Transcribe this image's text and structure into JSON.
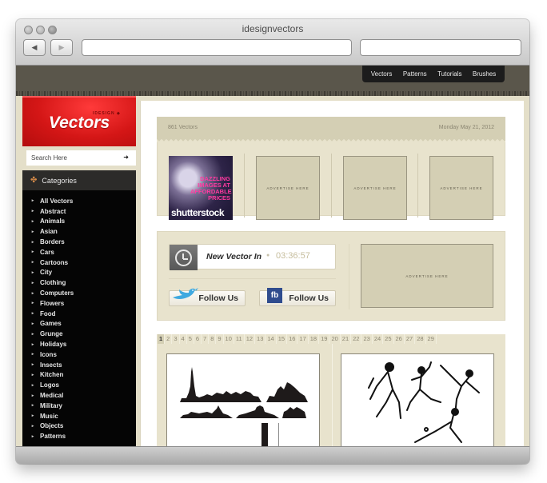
{
  "window": {
    "title": "idesignvectors"
  },
  "browser": {
    "back_icon": "back-arrow-icon",
    "forward_icon": "forward-arrow-icon",
    "back_glyph": "◀",
    "forward_glyph": "▶",
    "url_value": "",
    "search_value": ""
  },
  "top_nav": {
    "items": [
      "Vectors",
      "Patterns",
      "Tutorials",
      "Brushes"
    ]
  },
  "logo": {
    "small": "IDESIGN ◆",
    "text": "Vectors",
    "accent": "#d41616"
  },
  "search": {
    "placeholder": "Search Here",
    "submit_glyph": "➜"
  },
  "categories": {
    "heading": "Categories",
    "icon_glyph": "✤",
    "bullet": "▸",
    "items": [
      "All Vectors",
      "Abstract",
      "Animals",
      "Asian",
      "Borders",
      "Cars",
      "Cartoons",
      "City",
      "Clothing",
      "Computers",
      "Flowers",
      "Food",
      "Games",
      "Grunge",
      "Holidays",
      "Icons",
      "Insects",
      "Kitchen",
      "Logos",
      "Medical",
      "Military",
      "Music",
      "Objects",
      "Patterns"
    ]
  },
  "info_bar": {
    "count": "861 Vectors",
    "date": "Monday May 21, 2012"
  },
  "ads": {
    "shutterstock": {
      "tagline": "DAZZLING IMAGES AT AFFORDABLE PRICES",
      "brand": "shutterstock"
    },
    "placeholder": "ADVERTISE HERE"
  },
  "timer": {
    "label": "New Vector In",
    "separator": "●",
    "value": "03:36:57"
  },
  "follow": {
    "twitter_label": "Follow Us",
    "facebook_label": "Follow Us",
    "facebook_glyph": "fb"
  },
  "pagination": {
    "current": "1",
    "pages": [
      "1",
      "2",
      "3",
      "4",
      "5",
      "6",
      "7",
      "8",
      "9",
      "10",
      "11",
      "12",
      "13",
      "14",
      "15",
      "16",
      "17",
      "18",
      "19",
      "20",
      "21",
      "22",
      "23",
      "24",
      "25",
      "26",
      "27",
      "28",
      "29"
    ]
  },
  "thumbnails": [
    {
      "subject": "city-skyline-silhouettes"
    },
    {
      "subject": "baseball-players-illustration"
    }
  ]
}
